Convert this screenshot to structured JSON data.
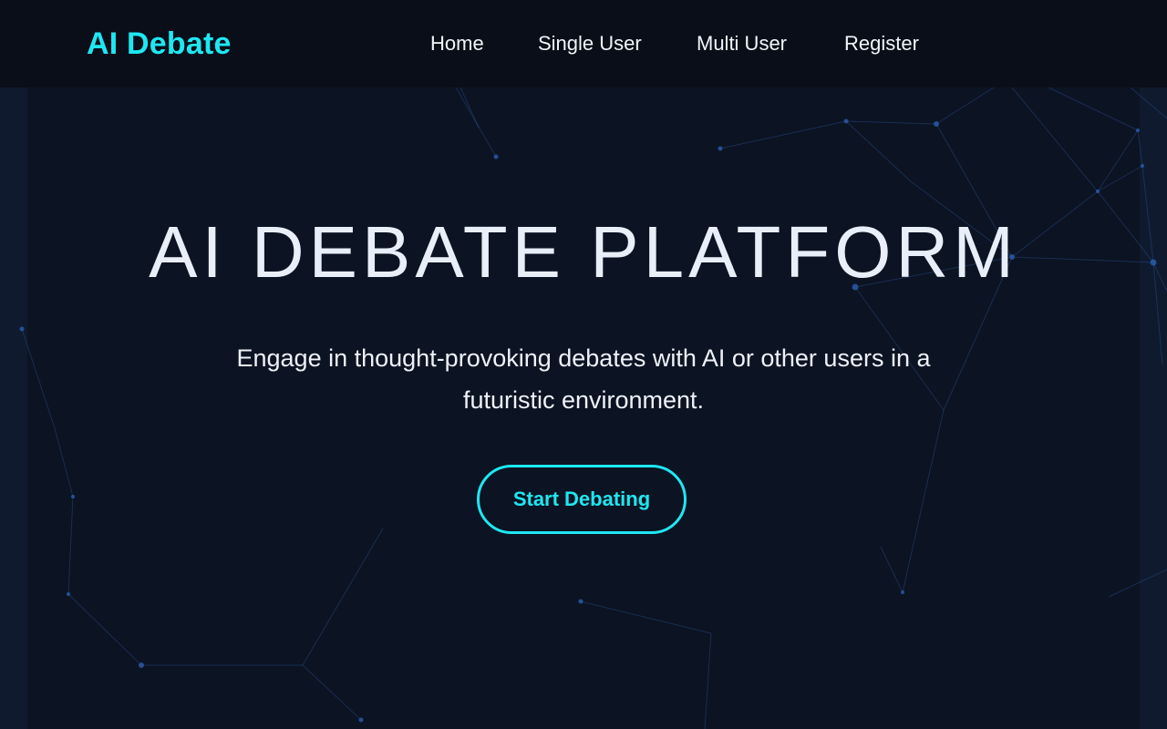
{
  "brand": {
    "name": "AI Debate",
    "accent_color": "#1ee7f1"
  },
  "nav": {
    "items": [
      {
        "label": "Home"
      },
      {
        "label": "Single User"
      },
      {
        "label": "Multi User"
      },
      {
        "label": "Register"
      }
    ]
  },
  "hero": {
    "title": "AI DEBATE PLATFORM",
    "subtitle": "Engage in thought-provoking debates with AI or other users in a futuristic environment.",
    "cta_label": "Start Debating"
  },
  "background": {
    "style": "particle-network",
    "base_color": "#0c1322",
    "line_color": "#2a4f8f"
  }
}
